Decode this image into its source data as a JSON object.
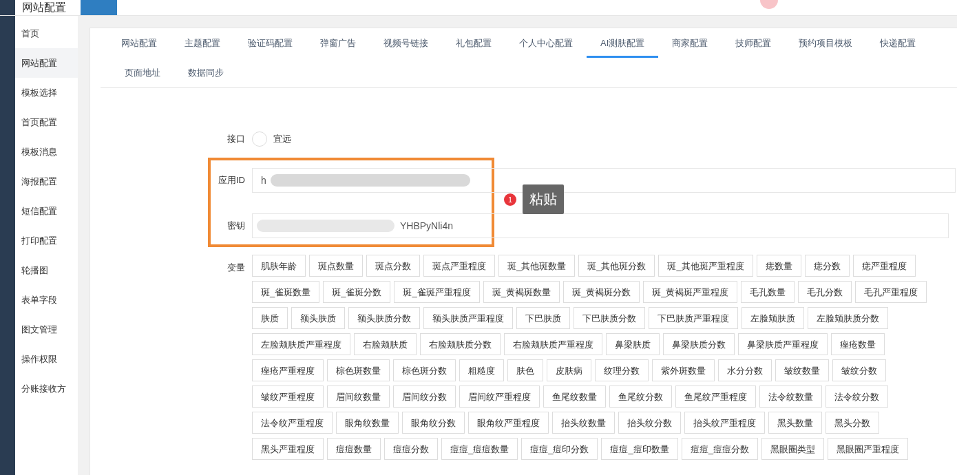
{
  "header": {
    "title": "网站配置"
  },
  "sidebar": {
    "items": [
      {
        "label": "首页",
        "selected": false
      },
      {
        "label": "网站配置",
        "selected": true
      },
      {
        "label": "模板选择",
        "selected": false
      },
      {
        "label": "首页配置",
        "selected": false
      },
      {
        "label": "模板消息",
        "selected": false
      },
      {
        "label": "海报配置",
        "selected": false
      },
      {
        "label": "短信配置",
        "selected": false
      },
      {
        "label": "打印配置",
        "selected": false
      },
      {
        "label": "轮播图",
        "selected": false
      },
      {
        "label": "表单字段",
        "selected": false
      },
      {
        "label": "图文管理",
        "selected": false
      },
      {
        "label": "操作权限",
        "selected": false
      },
      {
        "label": "分账接收方",
        "selected": false
      }
    ]
  },
  "tabs": [
    {
      "label": "网站配置",
      "selected": false
    },
    {
      "label": "主题配置",
      "selected": false
    },
    {
      "label": "验证码配置",
      "selected": false
    },
    {
      "label": "弹窗广告",
      "selected": false
    },
    {
      "label": "视频号链接",
      "selected": false
    },
    {
      "label": "礼包配置",
      "selected": false
    },
    {
      "label": "个人中心配置",
      "selected": false
    },
    {
      "label": "AI测肤配置",
      "selected": true
    },
    {
      "label": "商家配置",
      "selected": false
    },
    {
      "label": "技师配置",
      "selected": false
    },
    {
      "label": "预约项目模板",
      "selected": false
    },
    {
      "label": "快递配置",
      "selected": false
    },
    {
      "label": "页面地址",
      "selected": false
    },
    {
      "label": "数据同步",
      "selected": false
    }
  ],
  "form": {
    "interface": {
      "label": "接口",
      "options": [
        {
          "label": "宜远",
          "selected": false
        }
      ]
    },
    "app_id": {
      "label": "应用ID",
      "value": "h"
    },
    "secret": {
      "label": "密钥",
      "value": "YHBPyNli4n"
    },
    "variables": {
      "label": "变量",
      "tags": [
        "肌肤年龄",
        "斑点数量",
        "斑点分数",
        "斑点严重程度",
        "斑_其他斑数量",
        "斑_其他斑分数",
        "斑_其他斑严重程度",
        "痣数量",
        "痣分数",
        "痣严重程度",
        "斑_雀斑数量",
        "斑_雀斑分数",
        "斑_雀斑严重程度",
        "斑_黄褐斑数量",
        "斑_黄褐斑分数",
        "斑_黄褐斑严重程度",
        "毛孔数量",
        "毛孔分数",
        "毛孔严重程度",
        "肤质",
        "额头肤质",
        "额头肤质分数",
        "额头肤质严重程度",
        "下巴肤质",
        "下巴肤质分数",
        "下巴肤质严重程度",
        "左脸颊肤质",
        "左脸颊肤质分数",
        "左脸颊肤质严重程度",
        "右脸颊肤质",
        "右脸颊肤质分数",
        "右脸颊肤质严重程度",
        "鼻梁肤质",
        "鼻梁肤质分数",
        "鼻梁肤质严重程度",
        "痤疮数量",
        "痤疮严重程度",
        "棕色斑数量",
        "棕色斑分数",
        "粗糙度",
        "肤色",
        "皮肤病",
        "纹理分数",
        "紫外斑数量",
        "水分分数",
        "皱纹数量",
        "皱纹分数",
        "皱纹严重程度",
        "眉间纹数量",
        "眉间纹分数",
        "眉间纹严重程度",
        "鱼尾纹数量",
        "鱼尾纹分数",
        "鱼尾纹严重程度",
        "法令纹数量",
        "法令纹分数",
        "法令纹严重程度",
        "眼角纹数量",
        "眼角纹分数",
        "眼角纹严重程度",
        "抬头纹数量",
        "抬头纹分数",
        "抬头纹严重程度",
        "黑头数量",
        "黑头分数",
        "黑头严重程度",
        "痘痘数量",
        "痘痘分数",
        "痘痘_痘痘数量",
        "痘痘_痘印分数",
        "痘痘_痘印数量",
        "痘痘_痘痘分数",
        "黑眼圈类型",
        "黑眼圈严重程度"
      ]
    }
  },
  "annotation": {
    "badge": "1",
    "text": "粘贴"
  }
}
